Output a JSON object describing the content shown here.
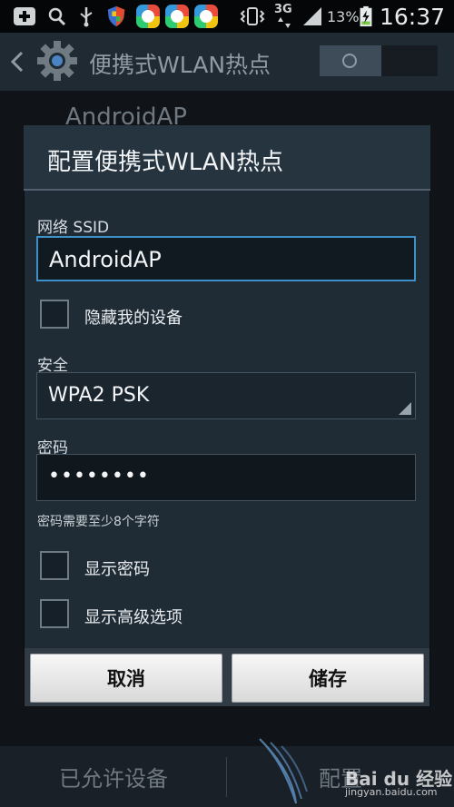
{
  "status_bar": {
    "network": "3G",
    "battery": "13%",
    "time": "16:37",
    "icons": [
      "add-icon",
      "search-icon",
      "usb-icon",
      "shield-icon",
      "app-icon",
      "app-icon",
      "app-icon",
      "vibrate-icon",
      "signal-icon",
      "battery-icon"
    ]
  },
  "action_bar": {
    "title": "便携式WLAN热点",
    "icons": [
      "back-icon",
      "settings-gear-icon"
    ]
  },
  "background": {
    "network_name": "AndroidAP",
    "allowed_devices": "已允许设备",
    "configure": "配置"
  },
  "dialog": {
    "title": "配置便携式WLAN热点",
    "ssid_label": "网络 SSID",
    "ssid_value": "AndroidAP",
    "hide_device_label": "隐藏我的设备",
    "security_label": "安全",
    "security_value": "WPA2 PSK",
    "password_label": "密码",
    "password_value": "••••••••",
    "password_hint": "密码需要至少8个字符",
    "show_password_label": "显示密码",
    "show_advanced_label": "显示高级选项",
    "cancel_label": "取消",
    "save_label": "储存"
  },
  "watermark": {
    "brand": "Bai du 经验",
    "url": "jingyan.baidu.com"
  },
  "colors": {
    "accent": "#3e90c9",
    "dialog_bg": "#1f2b35"
  }
}
